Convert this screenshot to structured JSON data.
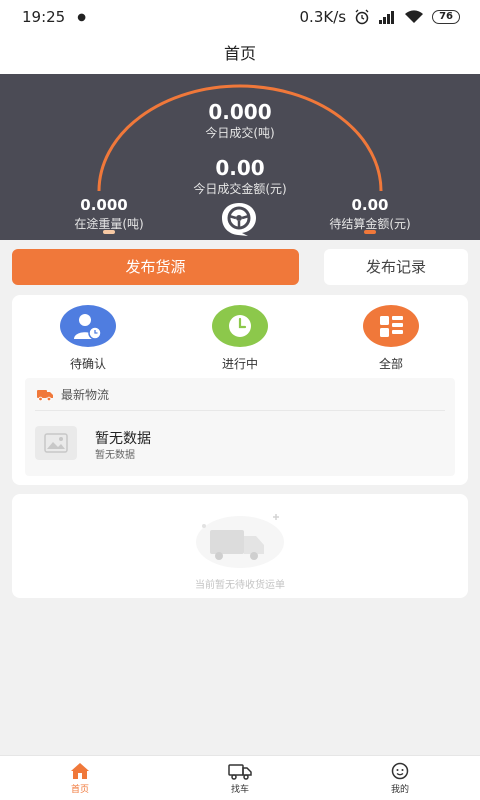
{
  "status_bar": {
    "time": "19:25",
    "net_speed": "0.3K/s",
    "battery": "76"
  },
  "header": {
    "title": "首页"
  },
  "dashboard": {
    "today_volume_value": "0.000",
    "today_volume_label": "今日成交(吨)",
    "today_amount_value": "0.00",
    "today_amount_label": "今日成交金额(元)",
    "transit_weight_value": "0.000",
    "transit_weight_label": "在途重量(吨)",
    "pending_amount_value": "0.00",
    "pending_amount_label": "待结算金额(元)",
    "colors": {
      "bg": "#4b4b55",
      "arc": "#f0783a",
      "left_dot": "#f7c9a4",
      "right_dot": "#f0783a"
    }
  },
  "actions": {
    "publish_label": "发布货源",
    "history_label": "发布记录"
  },
  "stats": [
    {
      "label": "待确认",
      "icon": "user-clock-icon",
      "color": "#4f7de0"
    },
    {
      "label": "进行中",
      "icon": "clock-icon",
      "color": "#8cc84b"
    },
    {
      "label": "全部",
      "icon": "grid-list-icon",
      "color": "#f0783a"
    }
  ],
  "logistics": {
    "header": "最新物流",
    "empty_title": "暂无数据",
    "empty_sub": "暂无数据"
  },
  "orders": {
    "empty_text": "当前暂无待收货运单"
  },
  "tabbar": [
    {
      "label": "首页",
      "icon": "home-icon",
      "active": true
    },
    {
      "label": "找车",
      "icon": "truck-icon",
      "active": false
    },
    {
      "label": "我的",
      "icon": "profile-icon",
      "active": false
    }
  ]
}
